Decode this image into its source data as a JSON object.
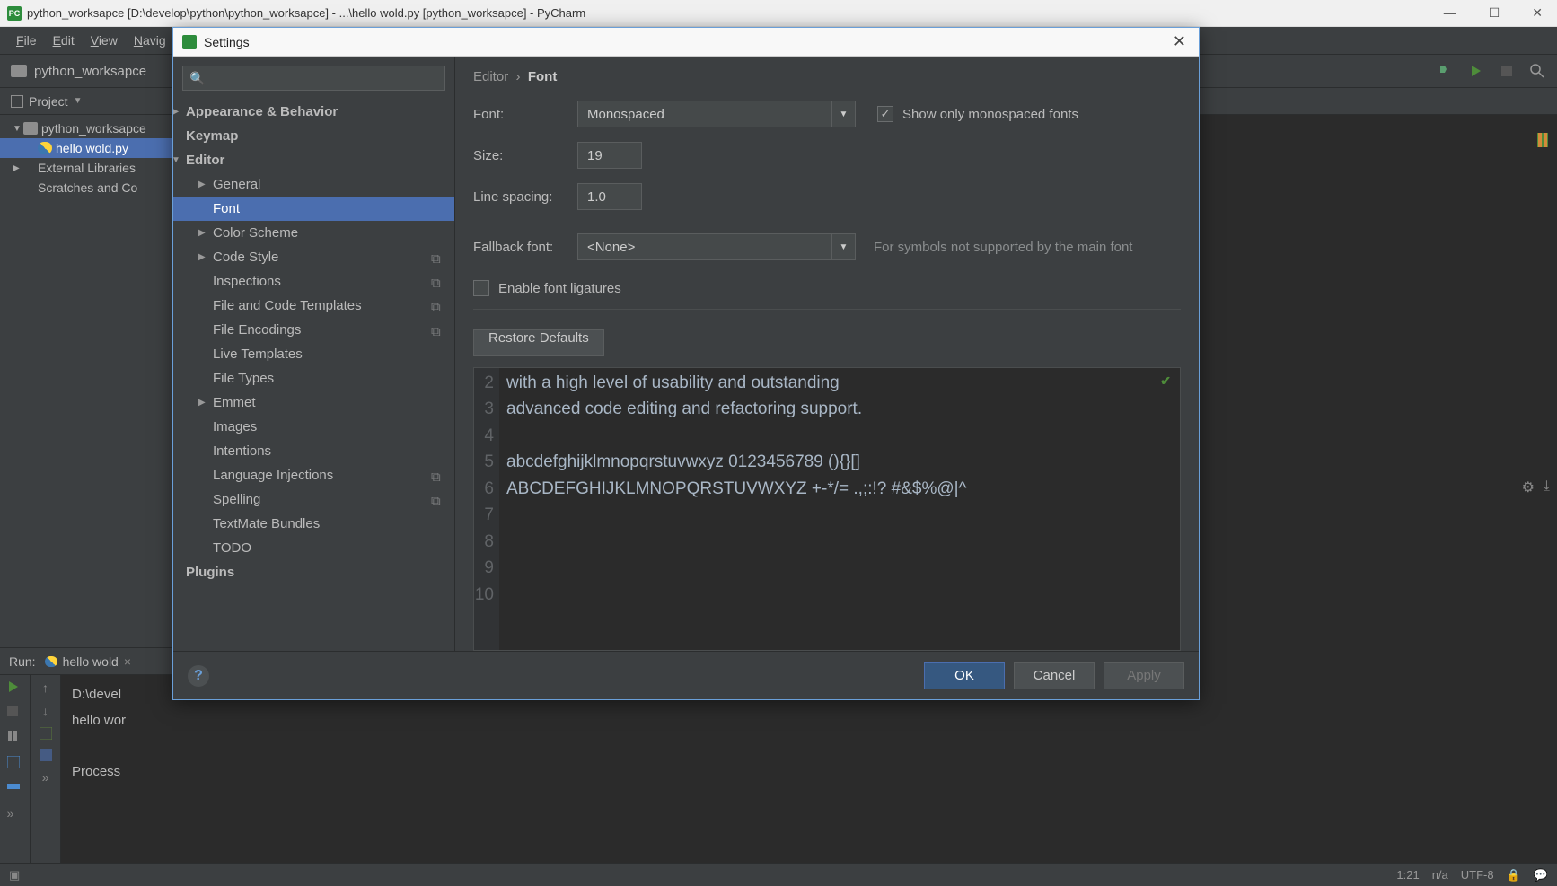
{
  "window": {
    "title": "python_worksapce [D:\\develop\\python\\python_worksapce] - ...\\hello wold.py [python_worksapce] - PyCharm"
  },
  "menu": {
    "file": "File",
    "edit": "Edit",
    "view": "View",
    "navigate": "Navig"
  },
  "nav": {
    "project_name": "python_worksapce"
  },
  "project_panel": {
    "label": "Project"
  },
  "tree": {
    "root": "python_worksapce",
    "file": "hello wold.py",
    "ext_libs": "External Libraries",
    "scratches": "Scratches and Co"
  },
  "run": {
    "label": "Run:",
    "tab": "hello wold",
    "out1": "D:\\devel",
    "out2": "hello wor",
    "out3": "Process "
  },
  "settings": {
    "title": "Settings",
    "search_placeholder": "",
    "categories": {
      "appearance": "Appearance & Behavior",
      "keymap": "Keymap",
      "editor": "Editor",
      "general": "General",
      "font": "Font",
      "color_scheme": "Color Scheme",
      "code_style": "Code Style",
      "inspections": "Inspections",
      "file_templates": "File and Code Templates",
      "file_encodings": "File Encodings",
      "live_templates": "Live Templates",
      "file_types": "File Types",
      "emmet": "Emmet",
      "images": "Images",
      "intentions": "Intentions",
      "lang_inj": "Language Injections",
      "spelling": "Spelling",
      "textmate": "TextMate Bundles",
      "todo": "TODO",
      "plugins": "Plugins"
    },
    "breadcrumb": {
      "parent": "Editor",
      "current": "Font"
    },
    "form": {
      "font_label": "Font:",
      "font_value": "Monospaced",
      "show_monospaced": "Show only monospaced fonts",
      "size_label": "Size:",
      "size_value": "19",
      "line_spacing_label": "Line spacing:",
      "line_spacing_value": "1.0",
      "fallback_label": "Fallback font:",
      "fallback_value": "<None>",
      "fallback_hint": "For symbols not supported by the main font",
      "ligatures": "Enable font ligatures",
      "restore": "Restore Defaults"
    },
    "preview": {
      "l2": "with a high level of usability and outstanding",
      "l3": "advanced code editing and refactoring support.",
      "l5": "abcdefghijklmnopqrstuvwxyz 0123456789 (){}[]",
      "l6": "ABCDEFGHIJKLMNOPQRSTUVWXYZ +-*/= .,;:!? #&$%@|^"
    },
    "buttons": {
      "ok": "OK",
      "cancel": "Cancel",
      "apply": "Apply"
    }
  },
  "status": {
    "pos": "1:21",
    "sep": "n/a",
    "enc": "UTF-8"
  }
}
